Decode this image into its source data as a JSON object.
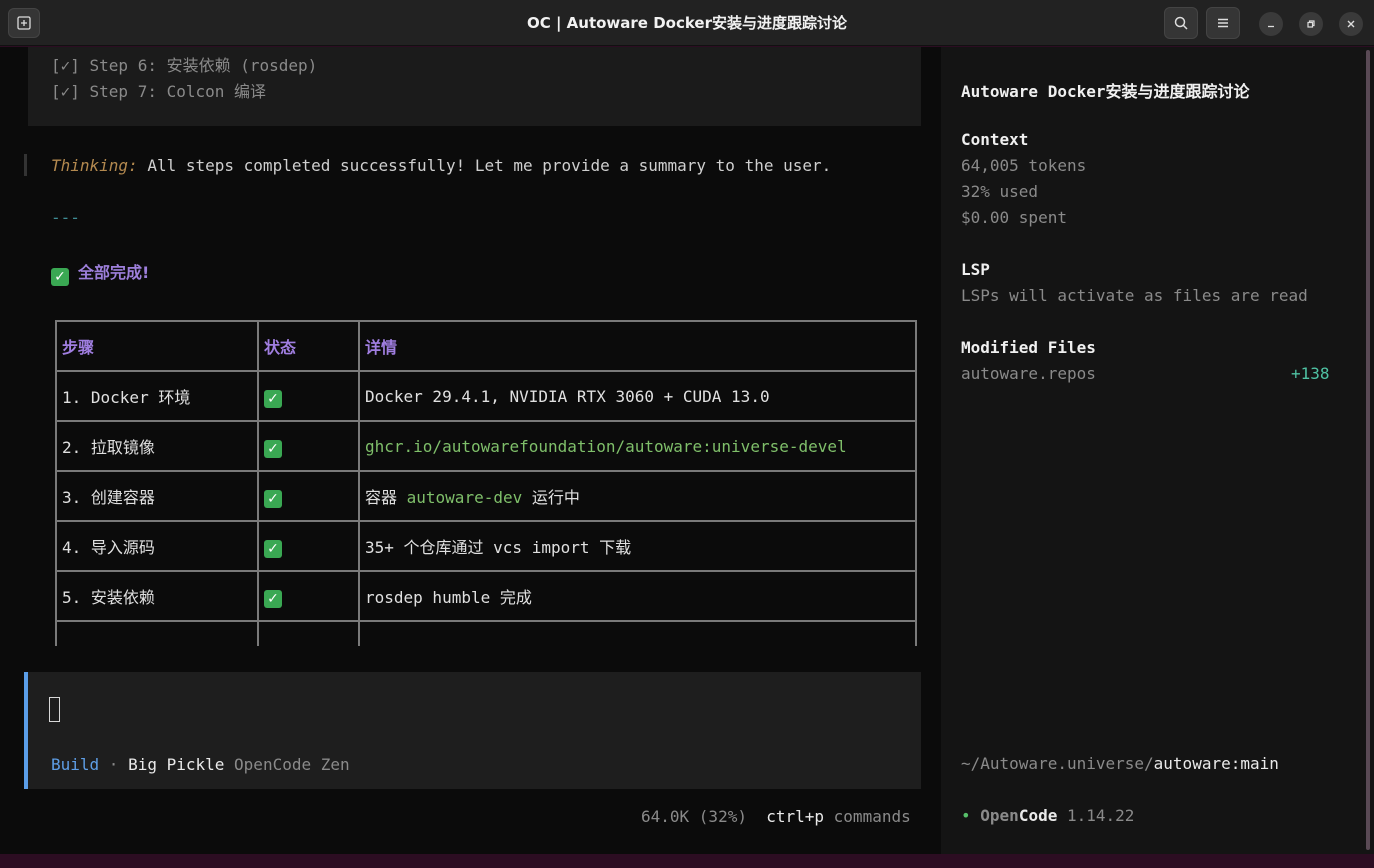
{
  "window": {
    "title": "OC | Autoware Docker安装与进度跟踪讨论"
  },
  "steps_done": [
    "[✓] Step 6: 安装依赖 (rosdep)",
    "[✓] Step 7: Colcon 编译"
  ],
  "thinking": {
    "label": "Thinking:",
    "text": " All steps completed successfully! Let me provide a summary to the user."
  },
  "separator": "---",
  "summary_heading": "全部完成!",
  "table": {
    "headers": [
      "步骤",
      "状态",
      "详情"
    ],
    "rows": [
      {
        "step": "1. Docker 环境",
        "status": "✓",
        "detail_pre": "Docker 29.4.1, NVIDIA RTX 3060 + CUDA 13.0",
        "detail_code": "",
        "detail_post": ""
      },
      {
        "step": "2. 拉取镜像",
        "status": "✓",
        "detail_pre": "",
        "detail_code": "ghcr.io/autowarefoundation/autoware:universe-devel",
        "detail_post": ""
      },
      {
        "step": "3. 创建容器",
        "status": "✓",
        "detail_pre": "容器 ",
        "detail_code": "autoware-dev",
        "detail_post": " 运行中"
      },
      {
        "step": "4. 导入源码",
        "status": "✓",
        "detail_pre": "35+ 个仓库通过 vcs import 下载",
        "detail_code": "",
        "detail_post": ""
      },
      {
        "step": "5. 安装依赖",
        "status": "✓",
        "detail_pre": "rosdep humble 完成",
        "detail_code": "",
        "detail_post": ""
      }
    ]
  },
  "input": {
    "mode": "Build",
    "sep": " · ",
    "model": "Big Pickle",
    "provider": " OpenCode Zen"
  },
  "status": {
    "usage": "64.0K (32%)",
    "shortcut": "ctrl+p",
    "shortcut_label": " commands"
  },
  "sidebar": {
    "title": "Autoware Docker安装与进度跟踪讨论",
    "context_label": "Context",
    "tokens": "64,005 tokens",
    "used": "32% used",
    "spent": "$0.00 spent",
    "lsp_label": "LSP",
    "lsp_text": "LSPs will activate as files are read",
    "modified_label": "Modified Files",
    "file_name": "autoware.repos",
    "file_delta": "+138",
    "path_dir": "~/Autoware.universe/",
    "path_branch": "autoware:main",
    "app_name_open": "Open",
    "app_name_code": "Code",
    "app_version": "1.14.22"
  }
}
